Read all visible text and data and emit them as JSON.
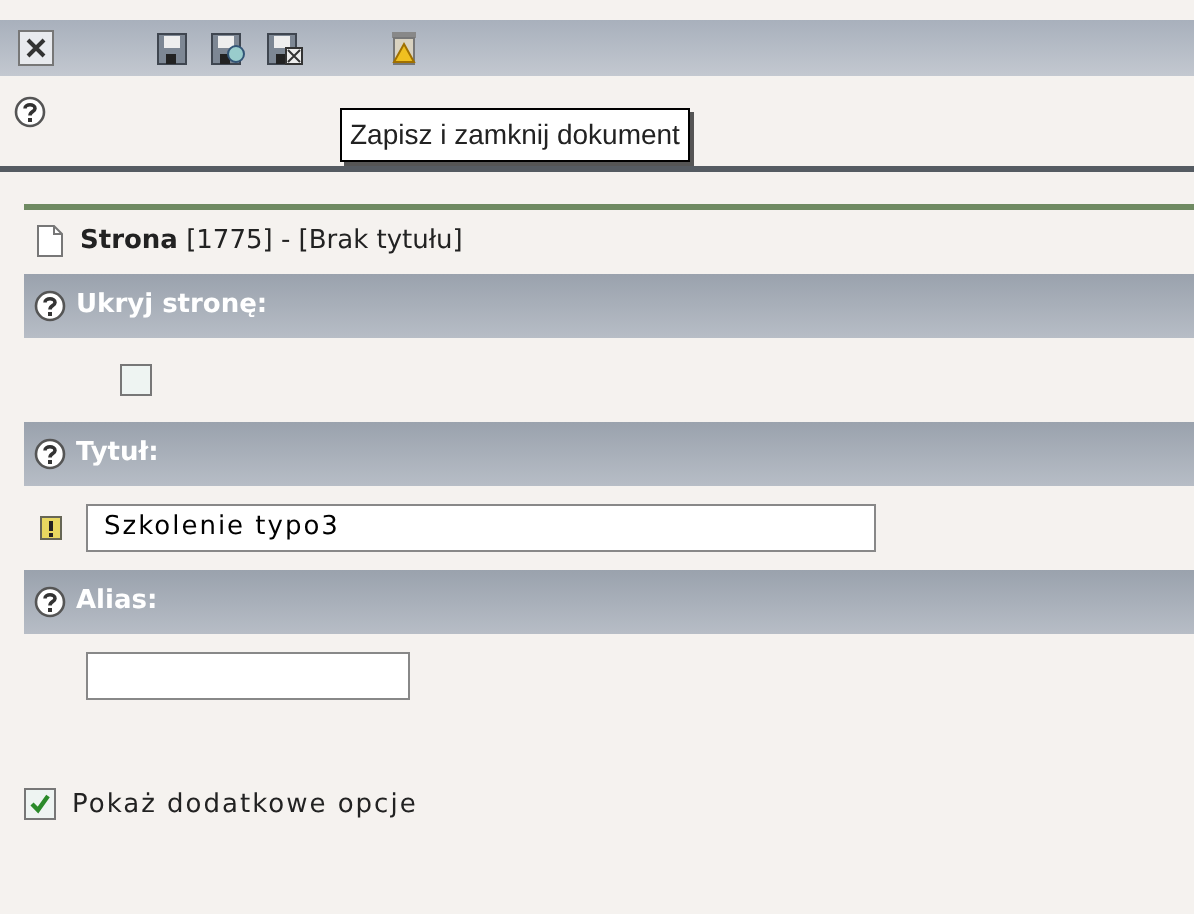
{
  "toolbar": {
    "buttons": [
      {
        "kind": "close"
      },
      {
        "kind": "save"
      },
      {
        "kind": "save-view"
      },
      {
        "kind": "save-close"
      },
      {
        "kind": "delete"
      }
    ]
  },
  "tooltip": {
    "text": "Zapisz i zamknij dokument"
  },
  "record_header": {
    "text": "**Strona** [1775] - [Brak tytułu]"
  },
  "fields": [
    {
      "label": "Ukryj stronę:",
      "kind": "checkbox",
      "checked": false,
      "required": false
    },
    {
      "label": "Tytuł:",
      "kind": "wide-text",
      "value": "Szkolenie typo3",
      "required": true
    },
    {
      "label": "Alias:",
      "kind": "short-text",
      "required": false
    }
  ],
  "more_options": {
    "label": "Pokaż dodatkowe opcje",
    "checked": true
  }
}
